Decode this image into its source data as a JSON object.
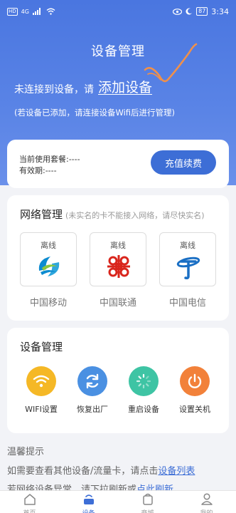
{
  "status_bar": {
    "hd": "HD",
    "signal": "4G",
    "battery": "87",
    "time": "3:34"
  },
  "header": {
    "title": "设备管理",
    "not_connected": "未连接到设备，请",
    "add_device": "添加设备",
    "note": "(若设备已添加，请连接设备Wifi后进行管理)"
  },
  "plan": {
    "current_plan": "当前使用套餐:----",
    "valid_until": "有效期:----",
    "recharge_button": "充值续费"
  },
  "network": {
    "title": "网络管理",
    "subtitle": "(未实名的卡不能接入网络，请尽快实名)",
    "carriers": [
      {
        "status": "离线",
        "name": "中国移动",
        "icon": "china-mobile-logo"
      },
      {
        "status": "离线",
        "name": "中国联通",
        "icon": "china-unicom-logo"
      },
      {
        "status": "离线",
        "name": "中国电信",
        "icon": "china-telecom-logo"
      }
    ]
  },
  "device": {
    "title": "设备管理",
    "functions": [
      {
        "label": "WIFI设置",
        "icon": "wifi-icon",
        "color": "#f5b826"
      },
      {
        "label": "恢复出厂",
        "icon": "refresh-icon",
        "color": "#4a90e2"
      },
      {
        "label": "重启设备",
        "icon": "restart-icon",
        "color": "#3ec4a4"
      },
      {
        "label": "设置关机",
        "icon": "power-icon",
        "color": "#f2813a"
      }
    ]
  },
  "tips": {
    "title": "温馨提示",
    "line1_prefix": "如需要查看其他设备/流量卡，请点击",
    "line1_link": "设备列表",
    "line2_prefix": "若网络设备异常，请下拉刷新或",
    "line2_link": "点此刷新"
  },
  "tabbar": [
    {
      "label": "首页",
      "icon": "home-icon"
    },
    {
      "label": "设备",
      "icon": "device-icon"
    },
    {
      "label": "商城",
      "icon": "shop-icon"
    },
    {
      "label": "我的",
      "icon": "user-icon"
    }
  ],
  "colors": {
    "primary": "#3d6ed6",
    "hero": "#4a76e0",
    "background": "#f2f3f7"
  }
}
